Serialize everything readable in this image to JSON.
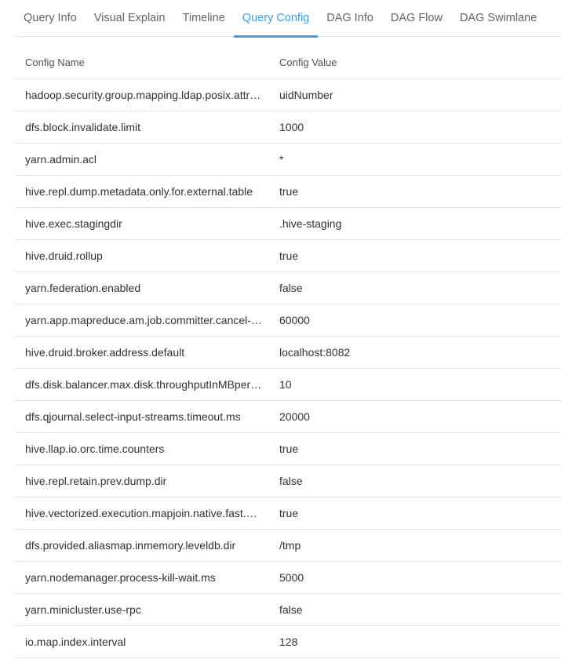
{
  "tabs": [
    {
      "label": "Query Info",
      "active": false
    },
    {
      "label": "Visual Explain",
      "active": false
    },
    {
      "label": "Timeline",
      "active": false
    },
    {
      "label": "Query Config",
      "active": true
    },
    {
      "label": "DAG Info",
      "active": false
    },
    {
      "label": "DAG Flow",
      "active": false
    },
    {
      "label": "DAG Swimlane",
      "active": false
    }
  ],
  "accent_color": "#3a9ff0",
  "table": {
    "headers": {
      "name": "Config Name",
      "value": "Config Value"
    },
    "rows": [
      {
        "name": "hadoop.security.group.mapping.ldap.posix.attr…",
        "value": "uidNumber"
      },
      {
        "name": "dfs.block.invalidate.limit",
        "value": "1000"
      },
      {
        "name": "yarn.admin.acl",
        "value": "*"
      },
      {
        "name": "hive.repl.dump.metadata.only.for.external.table",
        "value": "true"
      },
      {
        "name": "hive.exec.stagingdir",
        "value": ".hive-staging"
      },
      {
        "name": "hive.druid.rollup",
        "value": "true"
      },
      {
        "name": "yarn.federation.enabled",
        "value": "false"
      },
      {
        "name": "yarn.app.mapreduce.am.job.committer.cancel-…",
        "value": "60000"
      },
      {
        "name": "hive.druid.broker.address.default",
        "value": "localhost:8082"
      },
      {
        "name": "dfs.disk.balancer.max.disk.throughputInMBper…",
        "value": "10"
      },
      {
        "name": "dfs.qjournal.select-input-streams.timeout.ms",
        "value": "20000"
      },
      {
        "name": "hive.llap.io.orc.time.counters",
        "value": "true"
      },
      {
        "name": "hive.repl.retain.prev.dump.dir",
        "value": "false"
      },
      {
        "name": "hive.vectorized.execution.mapjoin.native.fast.…",
        "value": "true"
      },
      {
        "name": "dfs.provided.aliasmap.inmemory.leveldb.dir",
        "value": "/tmp"
      },
      {
        "name": "yarn.nodemanager.process-kill-wait.ms",
        "value": "5000"
      },
      {
        "name": "yarn.minicluster.use-rpc",
        "value": "false"
      },
      {
        "name": "io.map.index.interval",
        "value": "128"
      }
    ]
  }
}
